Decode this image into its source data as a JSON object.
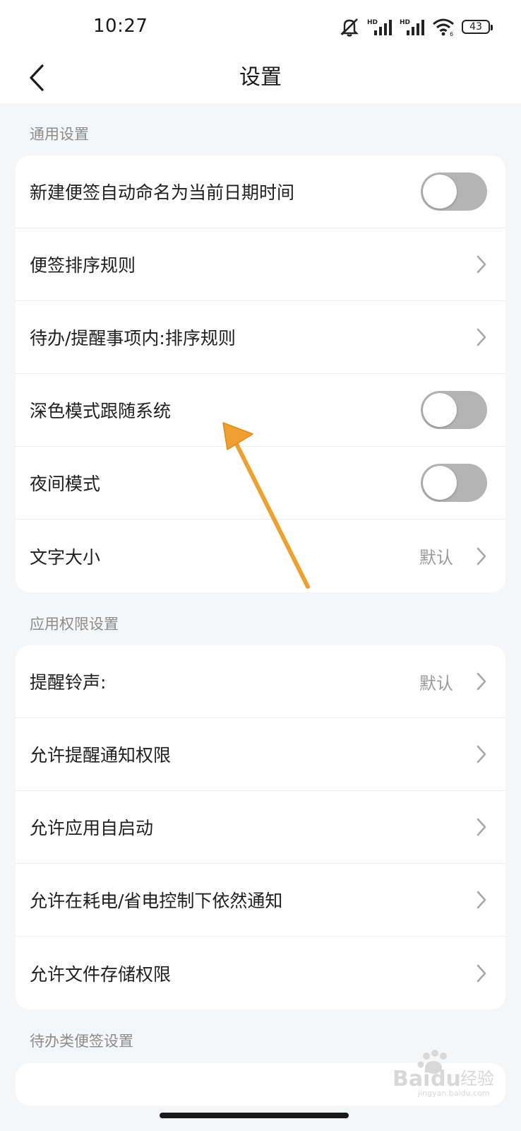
{
  "status_bar": {
    "time": "10:27",
    "battery": "43",
    "icons": [
      "mute-icon",
      "hd-signal-icon",
      "hd-signal-icon",
      "wifi-icon",
      "battery-icon"
    ]
  },
  "header": {
    "title": "设置",
    "back_icon": "chevron-left-icon"
  },
  "sections": [
    {
      "label": "通用设置",
      "rows": [
        {
          "label": "新建便签自动命名为当前日期时间",
          "type": "toggle",
          "on": false
        },
        {
          "label": "便签排序规则",
          "type": "link"
        },
        {
          "label": "待办/提醒事项内:排序规则",
          "type": "link"
        },
        {
          "label": "深色模式跟随系统",
          "type": "toggle",
          "on": false
        },
        {
          "label": "夜间模式",
          "type": "toggle",
          "on": false
        },
        {
          "label": "文字大小",
          "type": "link",
          "value": "默认"
        }
      ]
    },
    {
      "label": "应用权限设置",
      "rows": [
        {
          "label": "提醒铃声:",
          "type": "link",
          "value": "默认"
        },
        {
          "label": "允许提醒通知权限",
          "type": "link"
        },
        {
          "label": "允许应用自启动",
          "type": "link"
        },
        {
          "label": "允许在耗电/省电控制下依然通知",
          "type": "link"
        },
        {
          "label": "允许文件存储权限",
          "type": "link"
        }
      ]
    },
    {
      "label": "待办类便签设置"
    }
  ],
  "annotation": {
    "color": "#f0a030"
  },
  "watermark": {
    "text": "Baidu经验",
    "subtext": "jingyan.baidu.com"
  },
  "colors": {
    "background": "#f5f6f8",
    "card": "#ffffff",
    "toggle_off": "#b4b4b4",
    "secondary_text": "#8c8c8c"
  }
}
